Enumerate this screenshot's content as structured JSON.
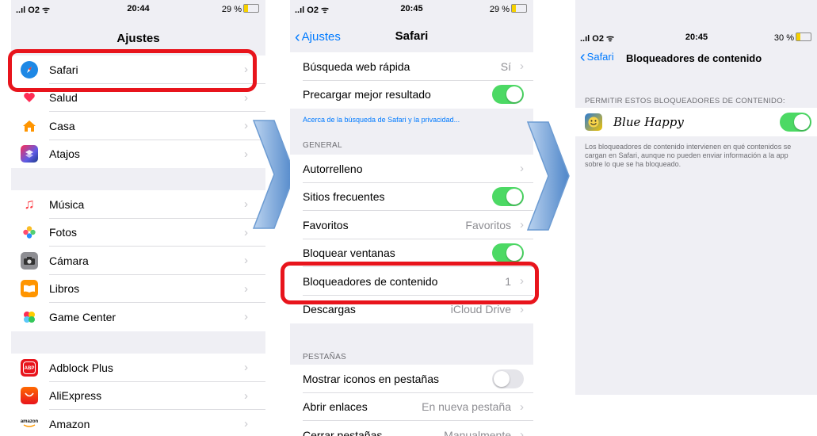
{
  "screen1": {
    "status": {
      "carrier": "..ıl O2 ᯤ",
      "time": "20:44",
      "battery": "29 %"
    },
    "title": "Ajustes",
    "group1": [
      {
        "label": "Safari",
        "icon": "safari-compass-icon",
        "color": "#1e88e5"
      },
      {
        "label": "Salud",
        "icon": "health-heart-icon",
        "color": "#ff2d55"
      },
      {
        "label": "Casa",
        "icon": "home-house-icon",
        "color": "#ff9500"
      },
      {
        "label": "Atajos",
        "icon": "shortcuts-icon",
        "color": "#5e5ce6"
      }
    ],
    "group2": [
      {
        "label": "Música",
        "icon": "music-note-icon",
        "color": "#fc3c44"
      },
      {
        "label": "Fotos",
        "icon": "photos-flower-icon",
        "color": "#f2a900"
      },
      {
        "label": "Cámara",
        "icon": "camera-icon",
        "color": "#6b6b6b"
      },
      {
        "label": "Libros",
        "icon": "books-icon",
        "color": "#ff9500"
      },
      {
        "label": "Game Center",
        "icon": "game-center-icon",
        "color": "#34c759"
      }
    ],
    "group3": [
      {
        "label": "Adblock Plus",
        "icon": "adblock-plus-icon",
        "color": "#e8141c",
        "glyph": "ABP"
      },
      {
        "label": "AliExpress",
        "icon": "aliexpress-icon",
        "color": "#ff6a00"
      },
      {
        "label": "Amazon",
        "icon": "amazon-icon",
        "color": "#ffffff",
        "glyph": "amazon"
      }
    ]
  },
  "screen2": {
    "status": {
      "carrier": "..ıl O2 ᯤ",
      "time": "20:45",
      "battery": "29 %"
    },
    "back": "Ajustes",
    "title": "Safari",
    "group1": [
      {
        "label": "Búsqueda web rápida",
        "value": "Sí",
        "type": "value"
      },
      {
        "label": "Precargar mejor resultado",
        "type": "toggle-on"
      }
    ],
    "privacy_link": "Acerca de la búsqueda de Safari y la privacidad...",
    "general_header": "GENERAL",
    "group2": [
      {
        "label": "Autorrelleno",
        "type": "chevron"
      },
      {
        "label": "Sitios frecuentes",
        "type": "toggle-on"
      },
      {
        "label": "Favoritos",
        "value": "Favoritos",
        "type": "value"
      },
      {
        "label": "Bloquear ventanas",
        "type": "toggle-on"
      },
      {
        "label": "Bloqueadores de contenido",
        "value": "1",
        "type": "value"
      },
      {
        "label": "Descargas",
        "value": "iCloud Drive",
        "type": "value"
      }
    ],
    "tabs_header": "PESTAÑAS",
    "group3": [
      {
        "label": "Mostrar iconos en pestañas",
        "type": "toggle-off"
      },
      {
        "label": "Abrir enlaces",
        "value": "En nueva pestaña",
        "type": "value"
      },
      {
        "label": "Cerrar pestañas",
        "value": "Manualmente",
        "type": "value"
      }
    ]
  },
  "screen3": {
    "status": {
      "carrier": "..ıl O2 ᯤ",
      "time": "20:45",
      "battery": "30 %"
    },
    "back": "Safari",
    "title": "Bloqueadores de contenido",
    "header": "PERMITIR ESTOS BLOQUEADORES DE CONTENIDO:",
    "blocker": {
      "label": "Blue Happy",
      "enabled": true
    },
    "footnote": "Los bloqueadores de contenido intervienen en qué contenidos se cargan en Safari, aunque no pueden enviar información a la app sobre lo que se ha bloqueado."
  },
  "colors": {
    "accent": "#007aff",
    "toggle_on": "#4cd964",
    "highlight": "#e8141c",
    "arrow": "#6c9bd2"
  }
}
